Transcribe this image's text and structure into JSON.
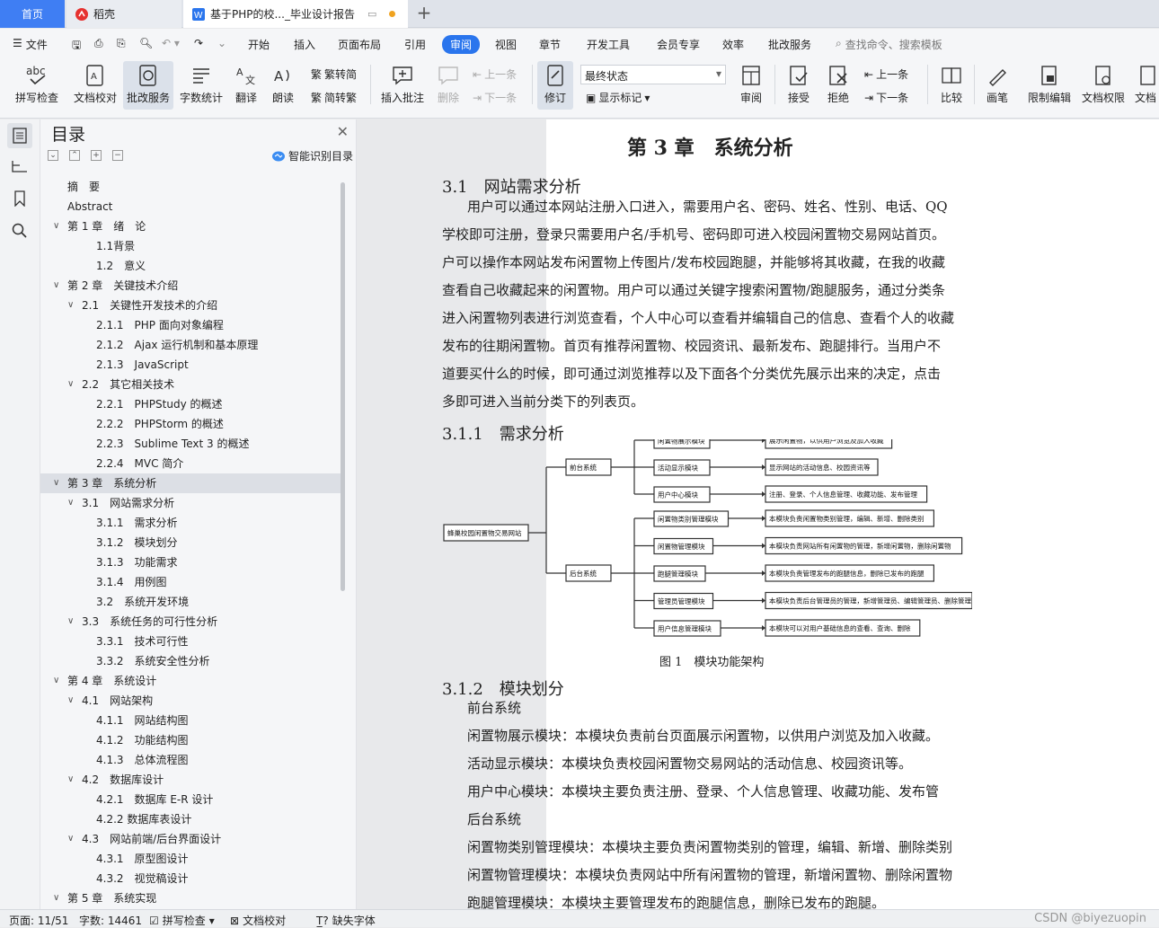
{
  "tabs": {
    "home": "首页",
    "daoke": "稻壳",
    "doc": "基于PHP的校..._毕业设计报告"
  },
  "menu": {
    "file": "文件",
    "items": [
      "开始",
      "插入",
      "页面布局",
      "引用",
      "审阅",
      "视图",
      "章节",
      "开发工具",
      "会员专享",
      "效率",
      "批改服务"
    ],
    "search": "查找命令、搜索模板"
  },
  "ribbon": {
    "spell": "拼写检查",
    "doccheck": "文档校对",
    "correct": "批改服务",
    "wordcount": "字数统计",
    "translate": "翻译",
    "read": "朗读",
    "trad": "繁转简",
    "simp": "简转繁",
    "addcomment": "插入批注",
    "delete": "删除",
    "prev": "上一条",
    "next": "下一条",
    "track": "修订",
    "state": "最终状态",
    "showmark": "显示标记",
    "review": "审阅",
    "accept": "接受",
    "reject": "拒绝",
    "prev2": "上一条",
    "next2": "下一条",
    "compare": "比较",
    "pen": "画笔",
    "restrict": "限制编辑",
    "perm": "文档权限",
    "docmore": "文档"
  },
  "toc": {
    "title": "目录",
    "smart": "智能识别目录",
    "items": [
      {
        "t": "摘　要",
        "lv": 1,
        "c": false,
        "sel": false
      },
      {
        "t": "Abstract",
        "lv": 1,
        "c": false,
        "sel": false
      },
      {
        "t": "第 1 章　绪　论",
        "lv": 1,
        "c": true,
        "sel": false
      },
      {
        "t": "1.1背景",
        "lv": 2,
        "c": false,
        "sel": false
      },
      {
        "t": "1.2　意义",
        "lv": 2,
        "c": false,
        "sel": false
      },
      {
        "t": "第 2 章　关键技术介绍",
        "lv": 1,
        "c": true,
        "sel": false
      },
      {
        "t": "2.1　关键性开发技术的介绍",
        "lv": 2,
        "c": true,
        "sel": false
      },
      {
        "t": "2.1.1　PHP 面向对象编程",
        "lv": 3,
        "c": false,
        "sel": false
      },
      {
        "t": "2.1.2　Ajax 运行机制和基本原理",
        "lv": 3,
        "c": false,
        "sel": false
      },
      {
        "t": "2.1.3　JavaScript",
        "lv": 3,
        "c": false,
        "sel": false
      },
      {
        "t": "2.2　其它相关技术",
        "lv": 2,
        "c": true,
        "sel": false
      },
      {
        "t": "2.2.1　PHPStudy 的概述",
        "lv": 3,
        "c": false,
        "sel": false
      },
      {
        "t": "2.2.2　PHPStorm 的概述",
        "lv": 3,
        "c": false,
        "sel": false
      },
      {
        "t": "2.2.3　Sublime Text 3 的概述",
        "lv": 3,
        "c": false,
        "sel": false
      },
      {
        "t": "2.2.4　MVC 简介",
        "lv": 3,
        "c": false,
        "sel": false
      },
      {
        "t": "第 3 章　系统分析",
        "lv": 1,
        "c": true,
        "sel": true
      },
      {
        "t": "3.1　网站需求分析",
        "lv": 2,
        "c": true,
        "sel": false
      },
      {
        "t": "3.1.1　需求分析",
        "lv": 3,
        "c": false,
        "sel": false
      },
      {
        "t": "3.1.2　模块划分",
        "lv": 3,
        "c": false,
        "sel": false
      },
      {
        "t": "3.1.3　功能需求",
        "lv": 3,
        "c": false,
        "sel": false
      },
      {
        "t": "3.1.4　用例图",
        "lv": 3,
        "c": false,
        "sel": false
      },
      {
        "t": "3.2　系统开发环境",
        "lv": 2,
        "c": false,
        "sel": false
      },
      {
        "t": "3.3　系统任务的可行性分析",
        "lv": 2,
        "c": true,
        "sel": false
      },
      {
        "t": "3.3.1　技术可行性",
        "lv": 3,
        "c": false,
        "sel": false
      },
      {
        "t": "3.3.2　系统安全性分析",
        "lv": 3,
        "c": false,
        "sel": false
      },
      {
        "t": "第 4 章　系统设计",
        "lv": 1,
        "c": true,
        "sel": false
      },
      {
        "t": "4.1　网站架构",
        "lv": 2,
        "c": true,
        "sel": false
      },
      {
        "t": "4.1.1　网站结构图",
        "lv": 3,
        "c": false,
        "sel": false
      },
      {
        "t": "4.1.2　功能结构图",
        "lv": 3,
        "c": false,
        "sel": false
      },
      {
        "t": "4.1.3　总体流程图",
        "lv": 3,
        "c": false,
        "sel": false
      },
      {
        "t": "4.2　数据库设计",
        "lv": 2,
        "c": true,
        "sel": false
      },
      {
        "t": "4.2.1　数据库 E-R 设计",
        "lv": 3,
        "c": false,
        "sel": false
      },
      {
        "t": "4.2.2 数据库表设计",
        "lv": 3,
        "c": false,
        "sel": false
      },
      {
        "t": "4.3　网站前端/后台界面设计",
        "lv": 2,
        "c": true,
        "sel": false
      },
      {
        "t": "4.3.1　原型图设计",
        "lv": 3,
        "c": false,
        "sel": false
      },
      {
        "t": "4.3.2　视觉稿设计",
        "lv": 3,
        "c": false,
        "sel": false
      },
      {
        "t": "第 5 章　系统实现",
        "lv": 1,
        "c": true,
        "sel": false
      }
    ]
  },
  "doc": {
    "chapter": "第 3 章　系统分析",
    "s31": "3.1　网站需求分析",
    "para": [
      "用户可以通过本网站注册入口进入，需要用户名、密码、姓名、性别、电话、QQ",
      "学校即可注册，登录只需要用户名/手机号、密码即可进入校园闲置物交易网站首页。",
      "户可以操作本网站发布闲置物上传图片/发布校园跑腿，并能够将其收藏，在我的收藏",
      "查看自己收藏起来的闲置物。用户可以通过关键字搜索闲置物/跑腿服务，通过分类条",
      "进入闲置物列表进行浏览查看，个人中心可以查看并编辑自己的信息、查看个人的收藏",
      "发布的往期闲置物。首页有推荐闲置物、校园资讯、最新发布、跑腿排行。当用户不",
      "道要买什么的时候，即可通过浏览推荐以及下面各个分类优先展示出来的决定，点击",
      "多即可进入当前分类下的列表页。"
    ],
    "s311": "3.1.1　需求分析",
    "diagram": {
      "root": "蜂巢校园闲置物交易网站",
      "front": "前台系统",
      "back": "后台系统",
      "front_mods": [
        {
          "n": "闲置物展示模块",
          "d": "展示闲置物，以供用户浏览及加入收藏"
        },
        {
          "n": "活动显示模块",
          "d": "显示网站的活动信息、校园资讯等"
        },
        {
          "n": "用户中心模块",
          "d": "注册、登录、个人信息管理、收藏功能、发布管理"
        }
      ],
      "back_mods": [
        {
          "n": "闲置物类别管理模块",
          "d": "本模块负责闲置物类别管理，编辑、新增、删除类别"
        },
        {
          "n": "闲置物管理模块",
          "d": "本模块负责网站所有闲置物的管理，新增闲置物，删除闲置物"
        },
        {
          "n": "跑腿管理模块",
          "d": "本模块负责管理发布的跑腿信息，删除已发布的跑腿"
        },
        {
          "n": "管理员管理模块",
          "d": "本模块负责后台管理员的管理，新增管理员、编辑管理员、删除管理员"
        },
        {
          "n": "用户信息管理模块",
          "d": "本模块可以对用户基础信息的查看、查询、删除"
        }
      ]
    },
    "caption": "图 1　模块功能架构",
    "s312": "3.1.2　模块划分",
    "lines": [
      "前台系统",
      "闲置物展示模块：本模块负责前台页面展示闲置物，以供用户浏览及加入收藏。",
      "活动显示模块：本模块负责校园闲置物交易网站的活动信息、校园资讯等。",
      "用户中心模块：本模块主要负责注册、登录、个人信息管理、收藏功能、发布管",
      "后台系统",
      "闲置物类别管理模块：本模块主要负责闲置物类别的管理，编辑、新增、删除类别",
      "闲置物管理模块：本模块负责网站中所有闲置物的管理，新增闲置物、删除闲置物",
      "跑腿管理模块：本模块主要管理发布的跑腿信息，删除已发布的跑腿。"
    ]
  },
  "status": {
    "page": "页面: 11/51",
    "words": "字数: 14461",
    "spell": "拼写检查",
    "check": "文档校对",
    "font": "缺失字体",
    "watermark": "CSDN @biyezuopin"
  },
  "colors": {
    "accent": "#2a75ed",
    "tab_home": "#3f7ef3"
  }
}
